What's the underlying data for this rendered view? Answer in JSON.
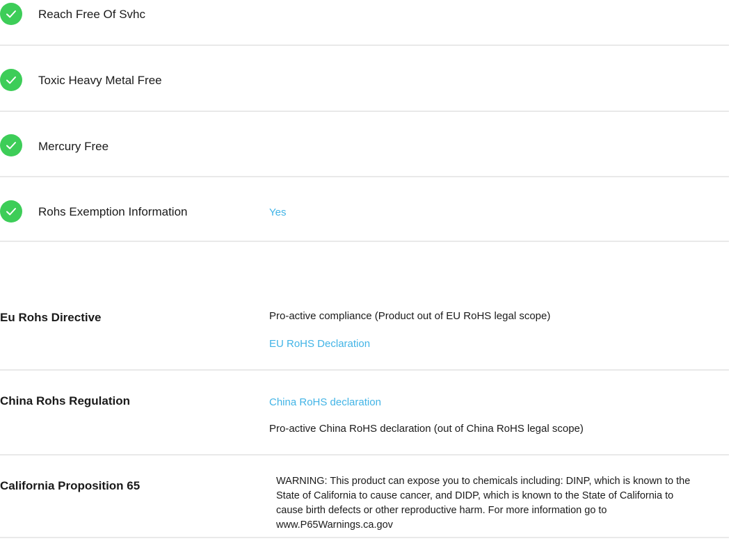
{
  "attributes": [
    {
      "label": "Reach Free Of Svhc",
      "icon": "check-circle-icon"
    },
    {
      "label": "Toxic Heavy Metal Free",
      "icon": "check-circle-icon"
    },
    {
      "label": "Mercury Free",
      "icon": "check-circle-icon"
    },
    {
      "label": "Rohs Exemption Information",
      "value": "Yes",
      "icon": "check-circle-icon"
    }
  ],
  "regulations": [
    {
      "heading": "Eu Rohs Directive",
      "text": "Pro-active compliance (Product out of EU RoHS legal scope)",
      "link": "EU RoHS Declaration"
    },
    {
      "heading": "China Rohs Regulation",
      "link": "China RoHS declaration",
      "text": "Pro-active China RoHS declaration (out of China RoHS legal scope)"
    },
    {
      "heading": "California Proposition 65",
      "text": "WARNING: This product can expose you to chemicals including: DINP, which is known to the State of California to cause cancer, and DIDP, which is known to the State of California to cause birth defects or other reproductive harm. For more information go to www.P65Warnings.ca.gov"
    }
  ],
  "colors": {
    "check": "#3dcd58",
    "link": "#42b4e6",
    "divider": "#e9e9e9"
  }
}
